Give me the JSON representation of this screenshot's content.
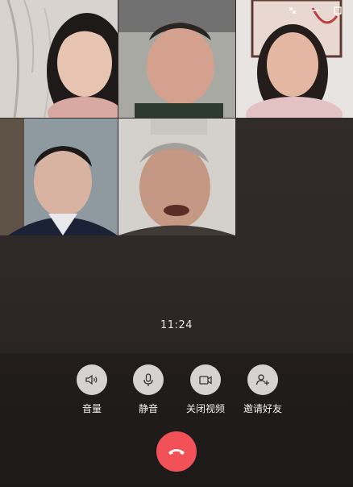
{
  "window": {
    "controls": [
      {
        "icon": "collapse-icon"
      },
      {
        "icon": "minimize-icon"
      },
      {
        "icon": "maximize-icon"
      }
    ]
  },
  "participants": [
    {
      "tile": "participant-1",
      "bg": "#d9d3cf"
    },
    {
      "tile": "participant-2",
      "bg": "#8a8a86"
    },
    {
      "tile": "participant-3",
      "bg": "#e8e4e1"
    },
    {
      "tile": "participant-4",
      "bg": "#9fa9ad"
    },
    {
      "tile": "participant-5",
      "bg": "#c9c6c2"
    }
  ],
  "call": {
    "timer": "11:24"
  },
  "controls": {
    "volume": {
      "label": "音量",
      "icon": "speaker-icon"
    },
    "mute": {
      "label": "静音",
      "icon": "microphone-icon"
    },
    "video": {
      "label": "关闭视频",
      "icon": "video-camera-icon"
    },
    "invite": {
      "label": "邀请好友",
      "icon": "add-user-icon"
    },
    "hangup": {
      "icon": "phone-hangup-icon",
      "color": "#f25158"
    }
  }
}
